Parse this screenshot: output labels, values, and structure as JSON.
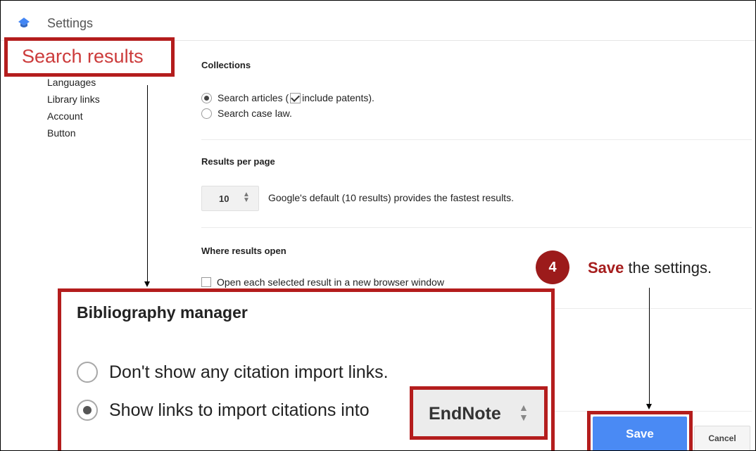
{
  "app": {
    "title": "Settings"
  },
  "sidebar": {
    "items": [
      "Languages",
      "Library links",
      "Account",
      "Button"
    ]
  },
  "sections": {
    "collections": {
      "title": "Collections",
      "options": [
        {
          "label_before": "Search articles (",
          "label_after": " include patents).",
          "selected": true
        },
        {
          "label": "Search case law.",
          "selected": false
        }
      ]
    },
    "results_per_page": {
      "title": "Results per page",
      "value": "10",
      "helper": "Google's default (10 results) provides the fastest results."
    },
    "where_results_open": {
      "title": "Where results open",
      "checkbox_label": "Open each selected result in a new browser window",
      "checked": false
    }
  },
  "buttons": {
    "save": "Save",
    "cancel": "Cancel"
  },
  "annotations": {
    "search_results_callout": "Search results",
    "bibliography": {
      "title": "Bibliography manager",
      "options": [
        {
          "label": "Don't show any citation import links.",
          "selected": false
        },
        {
          "label": "Show links to import citations into",
          "selected": true
        }
      ],
      "selected_manager": "EndNote"
    },
    "step": {
      "number": "4",
      "highlight": "Save",
      "text": " the settings."
    }
  },
  "colors": {
    "annotation_red": "#b41d1d",
    "save_blue": "#4a8af4",
    "logo_blue": "#4285f4"
  }
}
